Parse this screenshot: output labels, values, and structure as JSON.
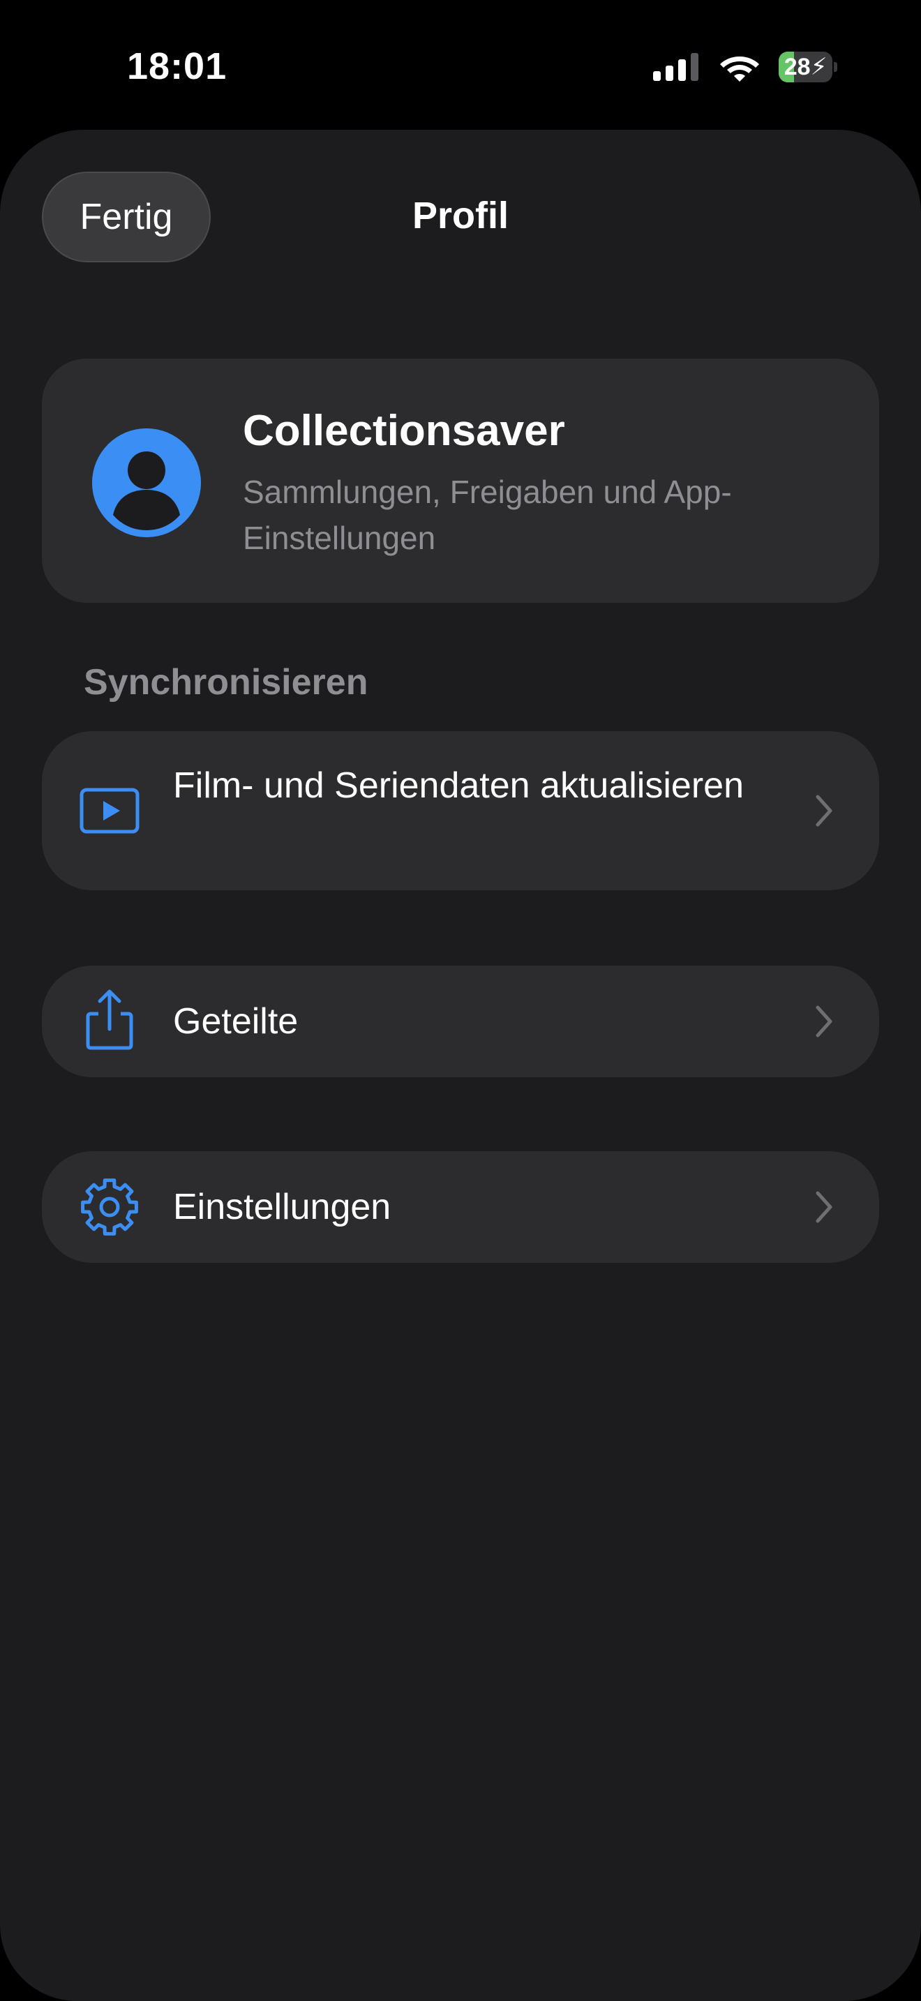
{
  "status_bar": {
    "time": "18:01",
    "battery_level": "28",
    "battery_fraction": 0.28,
    "battery_color": "#65c466",
    "icons": [
      "cellular-signal-icon",
      "wifi-icon",
      "battery-charging-icon"
    ]
  },
  "nav": {
    "done_label": "Fertig",
    "title": "Profil"
  },
  "profile": {
    "name": "Collectionsaver",
    "subtitle": "Sammlungen, Freigaben und App-Einstellungen",
    "avatar_icon": "person-circle-icon",
    "avatar_color": "#3b8ef3"
  },
  "sections": {
    "sync_header": "Synchronisieren"
  },
  "rows": {
    "sync": {
      "label": "Film- und Seriendaten aktualisieren",
      "icon": "play-rectangle-icon"
    },
    "shared": {
      "label": "Geteilte",
      "icon": "share-icon"
    },
    "settings": {
      "label": "Einstellungen",
      "icon": "gear-icon"
    }
  },
  "colors": {
    "accent": "#3b8ef3",
    "sheet_background": "#1c1c1e",
    "card_background": "#2c2c2e",
    "secondary_text": "#8e8e93"
  }
}
